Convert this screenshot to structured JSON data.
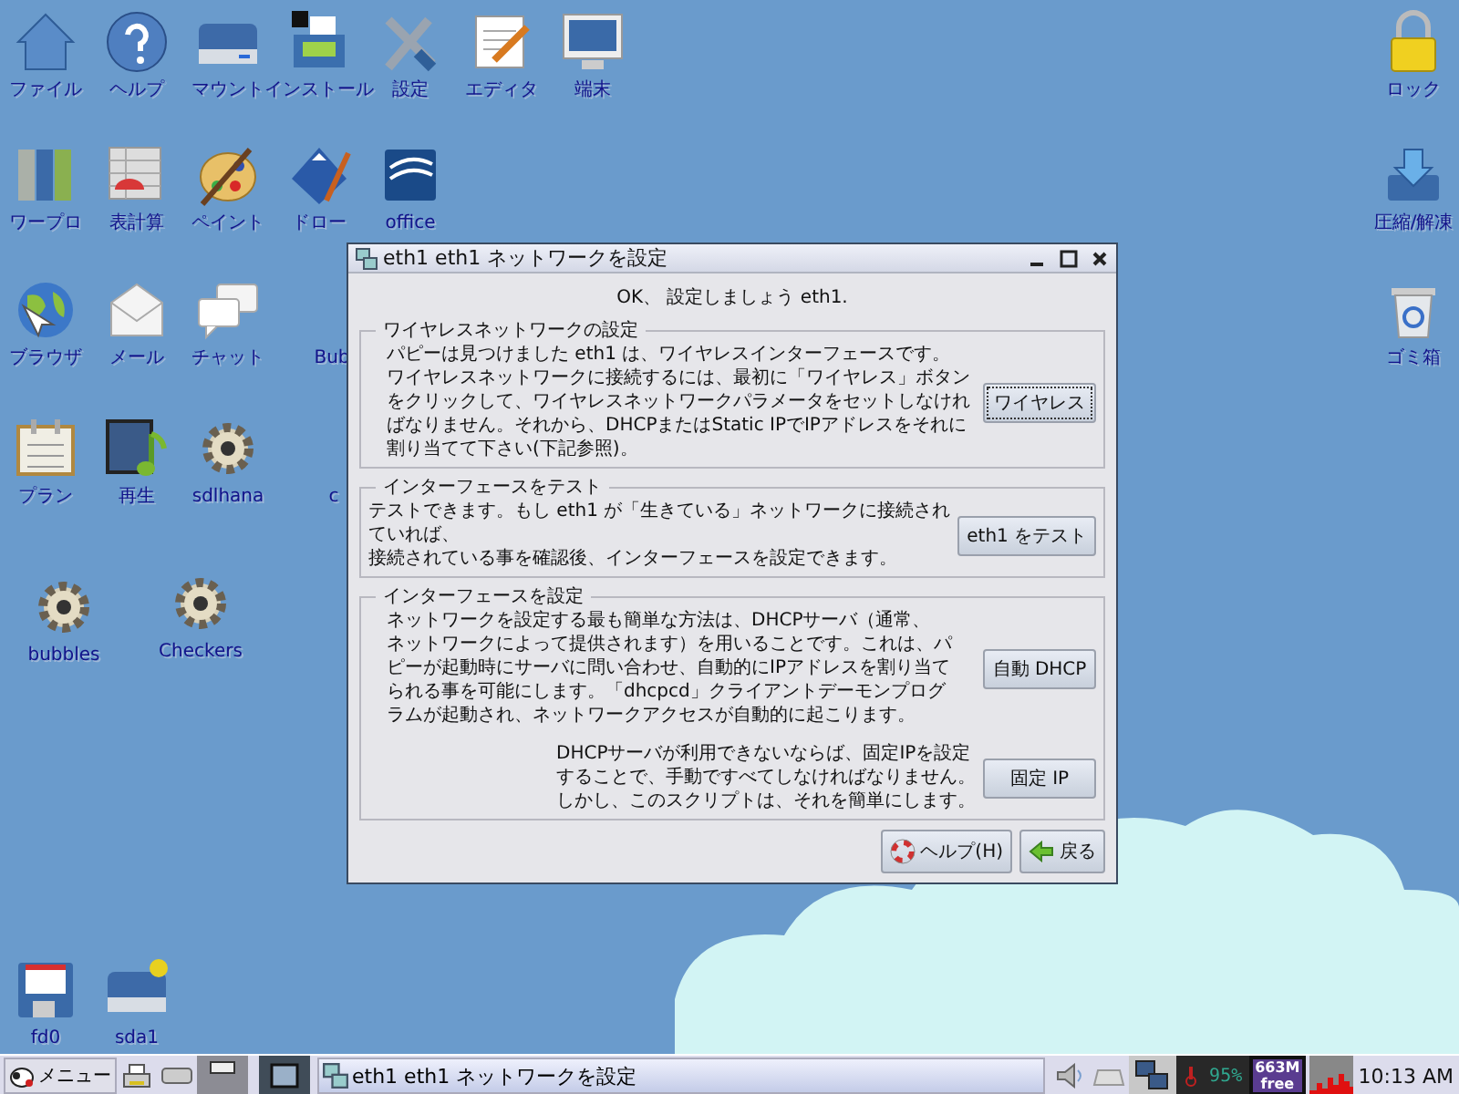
{
  "desktop_icons": [
    {
      "label": "ファイル"
    },
    {
      "label": "ヘルプ"
    },
    {
      "label": "マウント"
    },
    {
      "label": "インストール"
    },
    {
      "label": "設定"
    },
    {
      "label": "エディタ"
    },
    {
      "label": "端末"
    },
    {
      "label": "ワープロ"
    },
    {
      "label": "表計算"
    },
    {
      "label": "ペイント"
    },
    {
      "label": "ドロー"
    },
    {
      "label": "office"
    },
    {
      "label": "ブラウザ"
    },
    {
      "label": "メール"
    },
    {
      "label": "チャット"
    },
    {
      "label": "Bub"
    },
    {
      "label": "プラン"
    },
    {
      "label": "再生"
    },
    {
      "label": "sdlhana"
    },
    {
      "label": "c"
    },
    {
      "label": "bubbles"
    },
    {
      "label": "Checkers"
    },
    {
      "label": "ロック"
    },
    {
      "label": "圧縮/解凍"
    },
    {
      "label": "ゴミ箱"
    },
    {
      "label": "fd0"
    },
    {
      "label": "sda1"
    }
  ],
  "dialog": {
    "title": "eth1 eth1 ネットワークを設定",
    "heading": "OK、 設定しましょう eth1.",
    "sections": [
      {
        "legend": "ワイヤレスネットワークの設定",
        "rows": [
          {
            "kind": "indented",
            "lines": [
              "パピーは見つけました eth1 は、ワイヤレスインターフェースです。",
              "ワイヤレスネットワークに接続するには、最初に「ワイヤレス」ボタン",
              "をクリックして、ワイヤレスネットワークパラメータをセットしなけれ",
              "ばなりません。それから、DHCPまたはStatic IPでIPアドレスをそれに",
              "割り当てて下さい(下記参照)。"
            ],
            "button": "ワイヤレス",
            "focused": true
          }
        ]
      },
      {
        "legend": "インターフェースをテスト",
        "rows": [
          {
            "kind": "plain",
            "lines": [
              "テストできます。もし eth1 が「生きている」ネットワークに接続され",
              "ていれば、",
              "接続されている事を確認後、インターフェースを設定できます。"
            ],
            "button": "eth1 をテスト",
            "focused": false
          }
        ]
      },
      {
        "legend": "インターフェースを設定",
        "rows": [
          {
            "kind": "indented",
            "lines": [
              "ネットワークを設定する最も簡単な方法は、DHCPサーバ（通常、",
              "ネットワークによって提供されます）を用いることです。これは、パ",
              "ピーが起動時にサーバに問い合わせ、自動的にIPアドレスを割り当て",
              "られる事を可能にします。「dhcpcd」クライアントデーモンプログ",
              "ラムが起動され、ネットワークアクセスが自動的に起こります。"
            ],
            "button": "自動 DHCP",
            "focused": false
          },
          {
            "kind": "right",
            "lines": [
              "DHCPサーバが利用できないならば、固定IPを設定",
              "することで、手動ですべてしなければなりません。",
              "しかし、このスクリプトは、それを簡単にします。"
            ],
            "button": "固定 IP",
            "focused": false
          }
        ]
      }
    ],
    "buttons": [
      "ヘルプ(H)",
      "戻る"
    ]
  },
  "taskbar": {
    "menu": "メニュー",
    "task": "eth1 eth1 ネットワークを設定",
    "cpu": "95%",
    "memory": [
      "663M",
      "free"
    ],
    "clock": "10:13 AM"
  }
}
